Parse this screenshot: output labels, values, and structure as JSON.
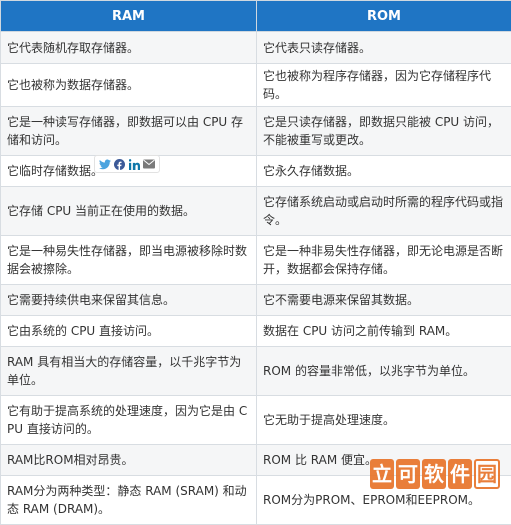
{
  "table": {
    "headers": [
      "RAM",
      "ROM"
    ],
    "rows": [
      [
        "它代表随机存取存储器。",
        "它代表只读存储器。"
      ],
      [
        "它也被称为数据存储器。",
        "它也被称为程序存储器，因为它存储程序代码。"
      ],
      [
        "它是一种读写存储器，即数据可以由 CPU 存储和访问。",
        "它是只读存储器，即数据只能被 CPU 访问，不能被重写或更改。"
      ],
      [
        "它临时存储数据。",
        "它永久存储数据。"
      ],
      [
        "它存储 CPU 当前正在使用的数据。",
        "它存储系统启动或启动时所需的程序代码或指令。"
      ],
      [
        "它是一种易失性存储器，即当电源被移除时数据会被擦除。",
        "它是一种非易失性存储器，即无论电源是否断开，数据都会保持存储。"
      ],
      [
        "它需要持续供电来保留其信息。",
        "它不需要电源来保留其数据。"
      ],
      [
        "它由系统的 CPU 直接访问。",
        "数据在 CPU 访问之前传输到 RAM。"
      ],
      [
        "RAM 具有相当大的存储容量，以千兆字节为单位。",
        "ROM 的容量非常低，以兆字节为单位。"
      ],
      [
        "它有助于提高系统的处理速度，因为它是由 CPU 直接访问的。",
        "它无助于提高处理速度。"
      ],
      [
        "RAM比ROM相对昂贵。",
        "ROM 比 RAM 便宜。"
      ],
      [
        "RAM分为两种类型：静态 RAM (SRAM) 和动态 RAM (DRAM)。",
        "ROM分为PROM、EPROM和EEPROM。"
      ]
    ]
  },
  "share_icons": [
    "twitter-icon",
    "facebook-icon",
    "linkedin-icon",
    "email-icon"
  ],
  "watermark": {
    "chars": [
      "立",
      "可",
      "软",
      "件",
      "园"
    ]
  },
  "colors": {
    "header_bg": "#1f75c4",
    "header_text": "#ffffff",
    "row_alt_bg": "#f5f6f7",
    "border": "#d8dde2",
    "watermark": "#e8742a"
  }
}
